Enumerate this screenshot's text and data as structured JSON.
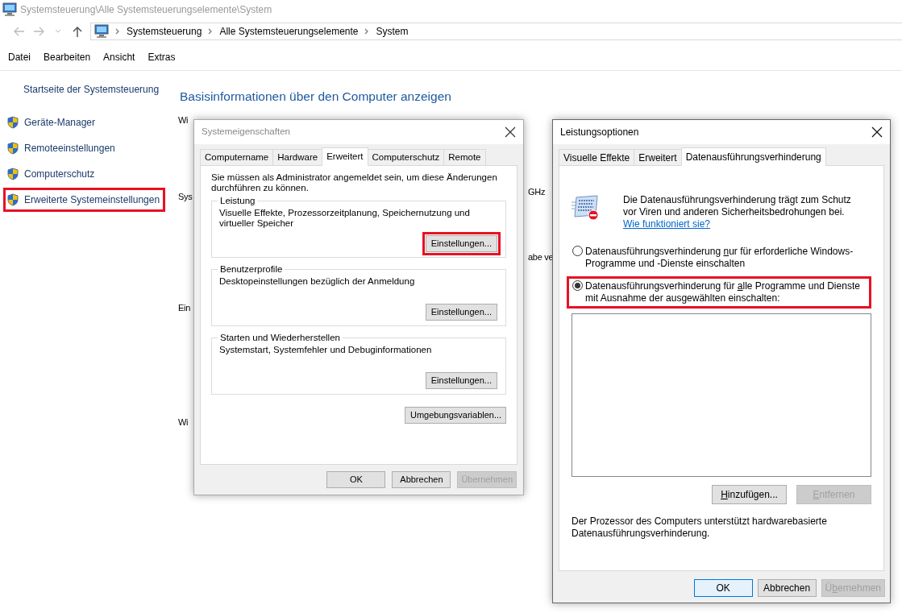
{
  "window": {
    "title": "Systemsteuerung\\Alle Systemsteuerungselemente\\System"
  },
  "address_bar": {
    "crumbs": [
      "Systemsteuerung",
      "Alle Systemsteuerungselemente",
      "System"
    ]
  },
  "menu": [
    "Datei",
    "Bearbeiten",
    "Ansicht",
    "Extras"
  ],
  "sidebar": {
    "home": "Startseite der Systemsteuerung",
    "items": [
      {
        "label": "Geräte-Manager",
        "highlighted": false
      },
      {
        "label": "Remoteeinstellungen",
        "highlighted": false
      },
      {
        "label": "Computerschutz",
        "highlighted": false
      },
      {
        "label": "Erweiterte Systemeinstellungen",
        "highlighted": true
      }
    ]
  },
  "main": {
    "heading": "Basisinformationen über den Computer anzeigen",
    "fragments": [
      "Wi",
      "Sys",
      "Ein",
      "Wi"
    ],
    "right_fragments": [
      "GHz",
      "abe ve"
    ]
  },
  "system_properties": {
    "title": "Systemeigenschaften",
    "tabs": [
      {
        "label": "Computername",
        "selected": false
      },
      {
        "label": "Hardware",
        "selected": false
      },
      {
        "label": "Erweitert",
        "selected": true
      },
      {
        "label": "Computerschutz",
        "selected": false
      },
      {
        "label": "Remote",
        "selected": false
      }
    ],
    "notice": "Sie müssen als Administrator angemeldet sein, um diese Änderungen durchführen zu können.",
    "groups": [
      {
        "title": "Leistung",
        "text": "Visuelle Effekte, Prozessorzeitplanung, Speichernutzung und virtueller Speicher",
        "button": {
          "label": "Einstellungen...",
          "highlighted": true
        }
      },
      {
        "title": "Benutzerprofile",
        "text": "Desktopeinstellungen bezüglich der Anmeldung",
        "button": {
          "label": "Einstellungen...",
          "highlighted": false
        }
      },
      {
        "title": "Starten und Wiederherstellen",
        "text": "Systemstart, Systemfehler und Debuginformationen",
        "button": {
          "label": "Einstellungen...",
          "highlighted": false
        }
      }
    ],
    "env_button": "Umgebungsvariablen...",
    "buttons": [
      {
        "label": "OK",
        "disabled": false
      },
      {
        "label": "Abbrechen",
        "disabled": false
      },
      {
        "label": "Übernehmen",
        "disabled": true
      }
    ]
  },
  "performance_options": {
    "title": "Leistungsoptionen",
    "tabs": [
      {
        "label": "Visuelle Effekte",
        "selected": false
      },
      {
        "label": "Erweitert",
        "selected": false
      },
      {
        "label": "Datenausführungsverhinderung",
        "selected": true
      }
    ],
    "intro": "Die Datenausführungsverhinderung trägt zum Schutz vor Viren und anderen Sicherheitsbedrohungen bei.",
    "help_link": "Wie funktioniert sie?",
    "options": [
      {
        "parts": [
          {
            "text": "Datenausführungsverhinderung ",
            "access_key": false
          },
          {
            "text": "n",
            "access_key": true
          },
          {
            "text": "ur für erforderliche Windows-Programme und -Dienste einschalten",
            "access_key": false
          }
        ],
        "selected": false,
        "highlighted": false
      },
      {
        "parts": [
          {
            "text": "Datenausführungsverhinderung für ",
            "access_key": false
          },
          {
            "text": "a",
            "access_key": true
          },
          {
            "text": "lle Programme und Dienste mit Ausnahme der ausgewählten einschalten:",
            "access_key": false
          }
        ],
        "selected": true,
        "highlighted": true
      }
    ],
    "list_buttons": [
      {
        "parts": [
          {
            "text": "H",
            "access_key": true
          },
          {
            "text": "inzufügen...",
            "access_key": false
          }
        ],
        "disabled": false
      },
      {
        "parts": [
          {
            "text": "E",
            "access_key": true
          },
          {
            "text": "ntfernen",
            "access_key": false
          }
        ],
        "disabled": true
      }
    ],
    "support_text": "Der Prozessor des Computers unterstützt hardwarebasierte Datenausführungsverhinderung.",
    "buttons": [
      {
        "parts": [
          {
            "text": "OK",
            "access_key": false
          }
        ],
        "disabled": false,
        "default": true
      },
      {
        "parts": [
          {
            "text": "Abbrechen",
            "access_key": false
          }
        ],
        "disabled": false,
        "default": false
      },
      {
        "parts": [
          {
            "text": "Ü",
            "access_key": false
          },
          {
            "text": "b",
            "access_key": true
          },
          {
            "text": "ernehmen",
            "access_key": false
          }
        ],
        "disabled": true,
        "default": false
      }
    ]
  }
}
